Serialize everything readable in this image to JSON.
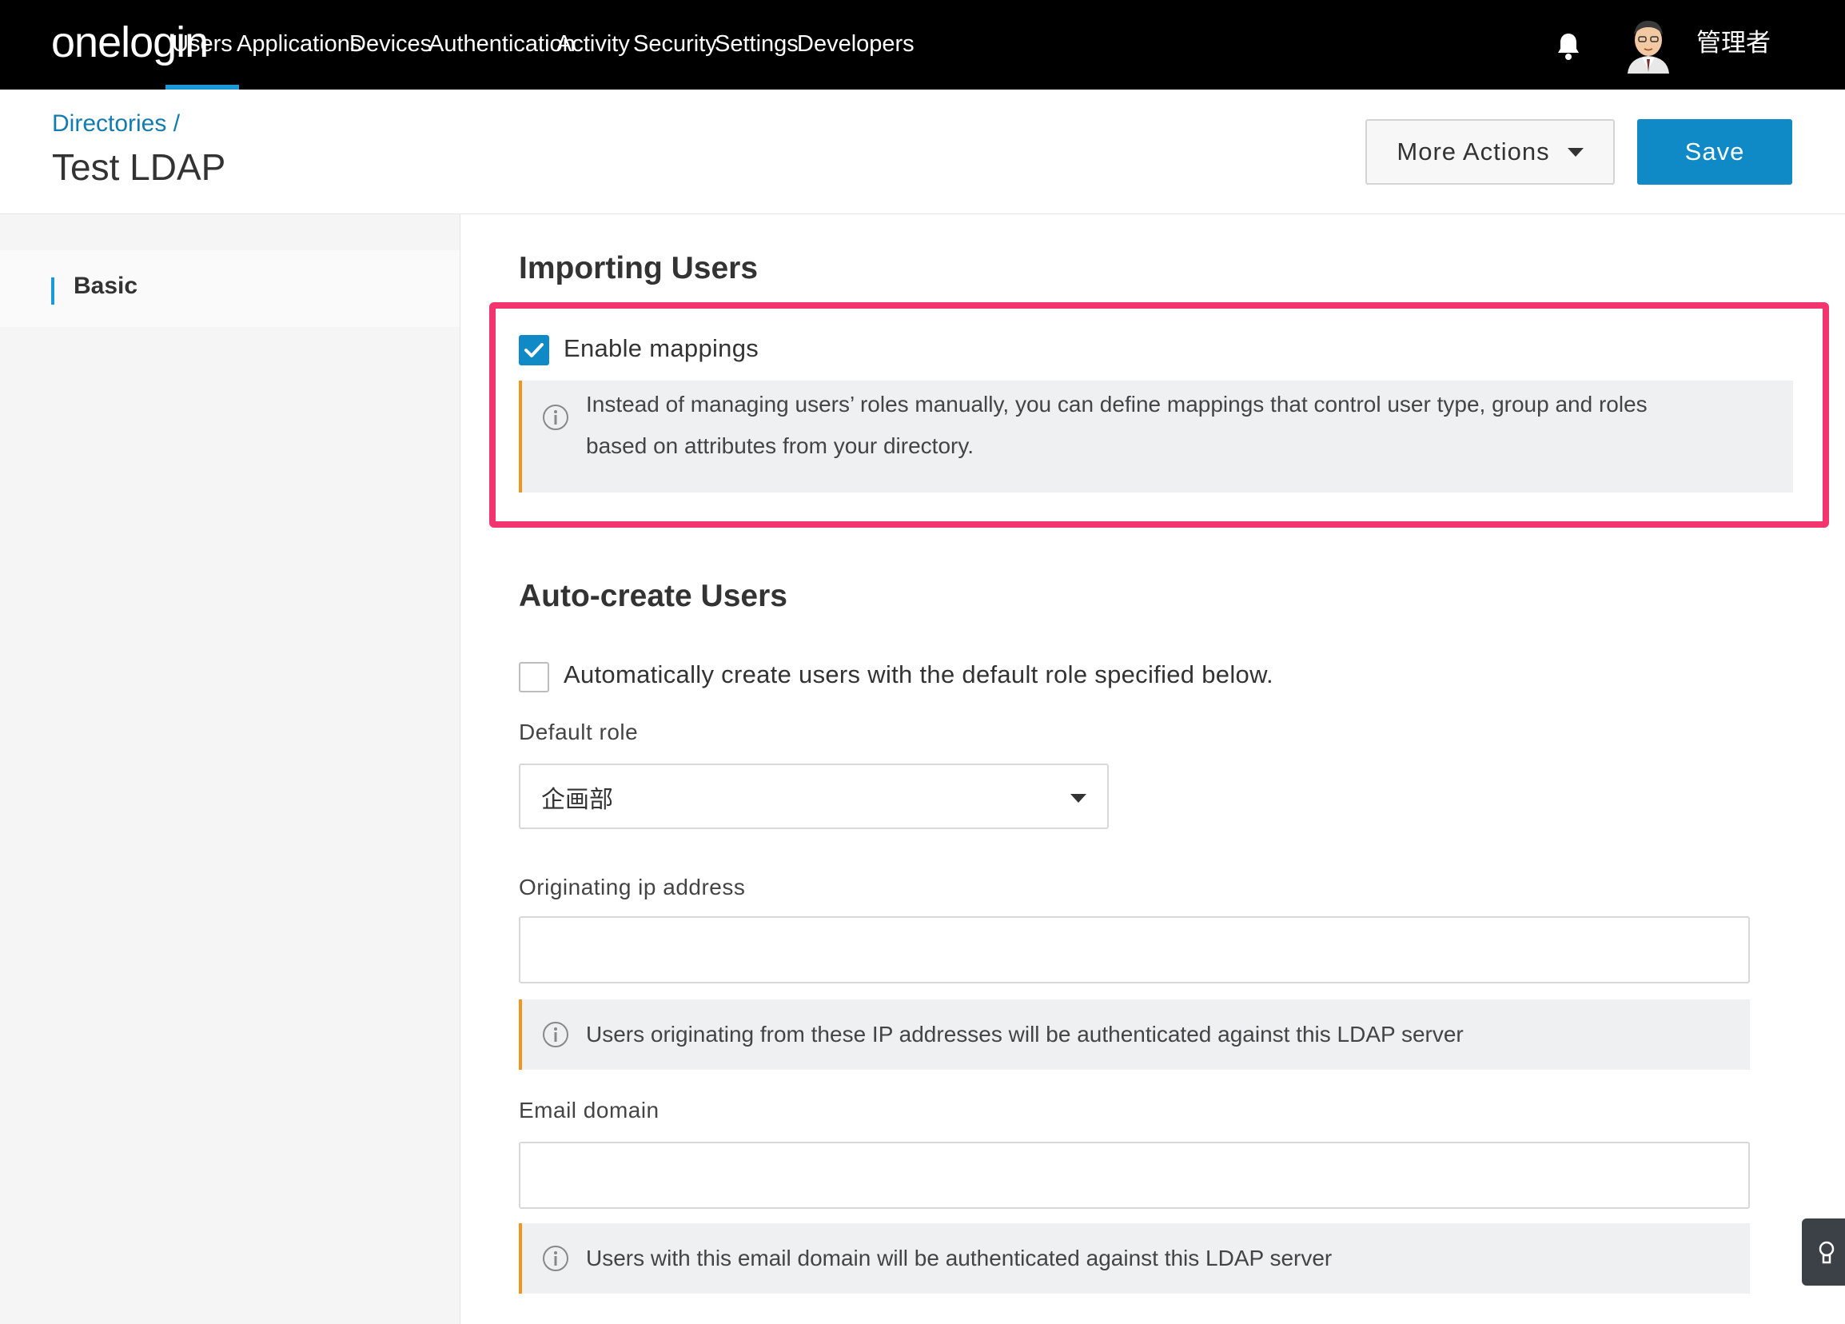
{
  "brand": {
    "logo_text": "onelogin"
  },
  "nav": {
    "items": [
      {
        "label": "Users",
        "active": true
      },
      {
        "label": "Applications"
      },
      {
        "label": "Devices"
      },
      {
        "label": "Authentication"
      },
      {
        "label": "Activity"
      },
      {
        "label": "Security"
      },
      {
        "label": "Settings"
      },
      {
        "label": "Developers"
      }
    ],
    "user_name": "管理者"
  },
  "header": {
    "breadcrumb": "Directories /",
    "title": "Test LDAP",
    "more_actions_label": "More Actions",
    "save_label": "Save"
  },
  "sidebar": {
    "items": [
      {
        "label": "Basic",
        "active": true
      }
    ]
  },
  "importing": {
    "title": "Importing Users",
    "enable_mappings": {
      "label": "Enable mappings",
      "checked": true
    },
    "info_line1": "Instead of managing users’ roles manually, you can define mappings that control user type, group and roles",
    "info_line2": "based on attributes from your directory."
  },
  "autocreate": {
    "title": "Auto-create Users",
    "checkbox": {
      "label": "Automatically create users with the default role specified below.",
      "checked": false
    },
    "default_role_label": "Default role",
    "default_role_value": "企画部",
    "originating_ip_label": "Originating ip address",
    "originating_ip_value": "",
    "originating_ip_info": "Users originating from these IP addresses will be authenticated against this LDAP server",
    "email_domain_label": "Email domain",
    "email_domain_value": "",
    "email_domain_info": "Users with this email domain will be authenticated against this LDAP server"
  },
  "colors": {
    "accent": "#1089c7",
    "highlight_border": "#f2356f",
    "info_border": "#f0961e",
    "nav_bg": "#000000"
  }
}
